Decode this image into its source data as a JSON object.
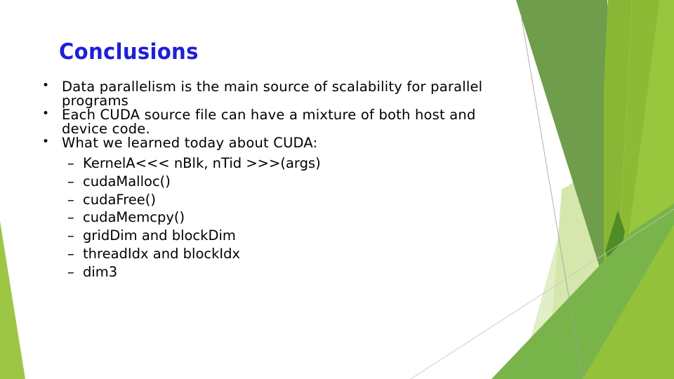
{
  "slide": {
    "title": "Conclusions",
    "bullets": [
      {
        "text": "Data parallelism is the main source of scalability for parallel programs"
      },
      {
        "text": "Each CUDA source file can have a mixture of both host and device code."
      },
      {
        "text": "What we learned today about CUDA:"
      }
    ],
    "sub_items": [
      "KernelA<<< nBlk, nTid >>>(args)",
      "cudaMalloc()",
      "cudaFree()",
      "cudaMemcpy()",
      "gridDim and blockDim",
      "threadIdx and blockIdx",
      "dim3"
    ],
    "bullet_glyph": "•",
    "dash_glyph": "–"
  },
  "theme": {
    "title_color": "#1f1fd8",
    "green_dark": "#6a9a44",
    "green_mid": "#86b432",
    "green_light": "#9cc93c",
    "green_pale": "#d7e8b0"
  }
}
